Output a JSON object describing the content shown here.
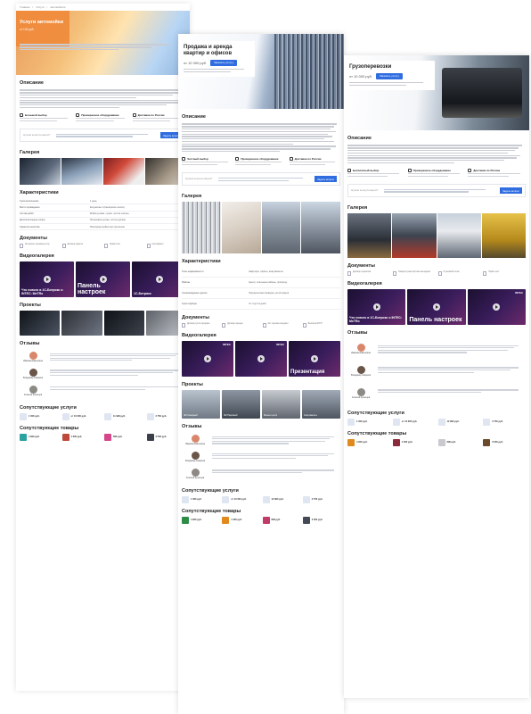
{
  "accent_color": "#2f6de0",
  "pages": {
    "auto": {
      "crumbs": [
        "Главная",
        "Услуги",
        "Автомобили"
      ],
      "hero_title": "Услуги автомойки",
      "price": "от 100 руб.",
      "sections": {
        "description": "Описание",
        "gallery": "Галерея",
        "characteristics": "Характеристики",
        "documents": "Документы",
        "videos": "Видеогалерея",
        "projects": "Проекты",
        "reviews": "Отзывы",
        "services": "Сопутствующие услуги",
        "goods": "Сопутствующие товары"
      },
      "features": [
        "Большой выбор",
        "Проверенное оборудование",
        "Доставка по России"
      ],
      "consult_q": "Нужна консультация?",
      "consult_btn": "Задать вопрос",
      "characteristics": [
        {
          "k": "Срок выполнения",
          "v": "1 день"
        },
        {
          "k": "Место проведения",
          "v": "Калужская 1 (Каширское шоссе)"
        },
        {
          "k": "Состав работ",
          "v": "Мойка кузова, сушка, чистка салона"
        },
        {
          "k": "Дополнительные опции",
          "v": "Полировка кузова, чистка дисков"
        },
        {
          "k": "Гарантия качества",
          "v": "Повторная мойка при претензии"
        }
      ],
      "documents": [
        "Регламент оказания услуг",
        "Договор-оферта",
        "Прайс-лист",
        "Сертификат"
      ],
      "videos": [
        "Что нового в 1С-Битрикс и INTEC: MeTRo",
        "Панель настроек",
        "1С-Битрикс"
      ],
      "reviewers": [
        "Иванова Екатерина",
        "Владимир Смирнов",
        "Алексей Кузнецов"
      ],
      "services": [
        "1 000 руб.",
        "от 10 000 руб.",
        "11 990 руб.",
        "2 750 руб."
      ],
      "goods": [
        "4 900 руб.",
        "1 300 руб.",
        "890 руб.",
        "3 500 руб."
      ]
    },
    "realty": {
      "hero_title": "Продажа и аренда квартир и офисов",
      "price": "от 12 000 руб.",
      "order": "Заказать услугу",
      "sections": {
        "description": "Описание",
        "gallery": "Галерея",
        "characteristics": "Характеристики",
        "documents": "Документы",
        "videos": "Видеогалерея",
        "projects": "Проекты",
        "reviews": "Отзывы",
        "services": "Сопутствующие услуги",
        "goods": "Сопутствующие товары"
      },
      "features": [
        "Честный выбор",
        "Проверенное оборудование",
        "Доставка по России"
      ],
      "consult_q": "Нужна консультация?",
      "consult_btn": "Задать вопрос",
      "characteristics": [
        {
          "k": "Типы недвижимости",
          "v": "Квартиры, офисы, апартаменты"
        },
        {
          "k": "Районы",
          "v": "Центр, спальные районы, пригород"
        },
        {
          "k": "Сопровождение сделки",
          "v": "Юридическая проверка, регистрация"
        },
        {
          "k": "Срок подбора",
          "v": "От 3 до 14 дней"
        }
      ],
      "documents": [
        "Договор купли-продажи",
        "Договор аренды",
        "Акт приема-передачи",
        "Выписка ЕГРН"
      ],
      "videos": [
        "INTEC",
        "INTEC",
        "Презентация"
      ],
      "projects": [
        "ЖК Северный",
        "ЖК Парковый",
        "Бизнес-центр",
        "Апартаменты"
      ],
      "reviewers": [
        "Иванова Екатерина",
        "Владимир Смирнов",
        "Алексей Кузнецов"
      ],
      "services": [
        "1 000 руб.",
        "от 10 000 руб.",
        "12 990 руб.",
        "2 750 руб."
      ],
      "goods": [
        "4 900 руб.",
        "1 300 руб.",
        "890 руб.",
        "3 500 руб."
      ]
    },
    "cargo": {
      "hero_title": "Грузоперевозки",
      "price": "от 10 000 руб.",
      "order": "Заказать услугу",
      "sections": {
        "description": "Описание",
        "gallery": "Галерея",
        "documents": "Документы",
        "videos": "Видеогалерея",
        "reviews": "Отзывы",
        "services": "Сопутствующие услуги",
        "goods": "Сопутствующие товары"
      },
      "features": [
        "Бесплатный выбор",
        "Проверенное оборудование",
        "Доставка по России"
      ],
      "consult_q": "Нужна консультация?",
      "consult_btn": "Задать вопрос",
      "documents": [
        "Договор перевозки",
        "Товарно-транспортная накладная",
        "Страховой полис",
        "Прайс-лист"
      ],
      "videos": [
        "Что нового в 1С-Битрикс и INTEC: MeTRo",
        "Панель настроек",
        "INTEC"
      ],
      "reviewers": [
        "Иванова Екатерина",
        "Владимир Смирнов",
        "Алексей Кузнецов"
      ],
      "services": [
        "1 000 руб.",
        "от 10 000 руб.",
        "12 990 руб.",
        "3 750 руб."
      ],
      "goods": [
        "4 900 руб.",
        "1 300 руб.",
        "890 руб.",
        "3 500 руб."
      ]
    }
  }
}
